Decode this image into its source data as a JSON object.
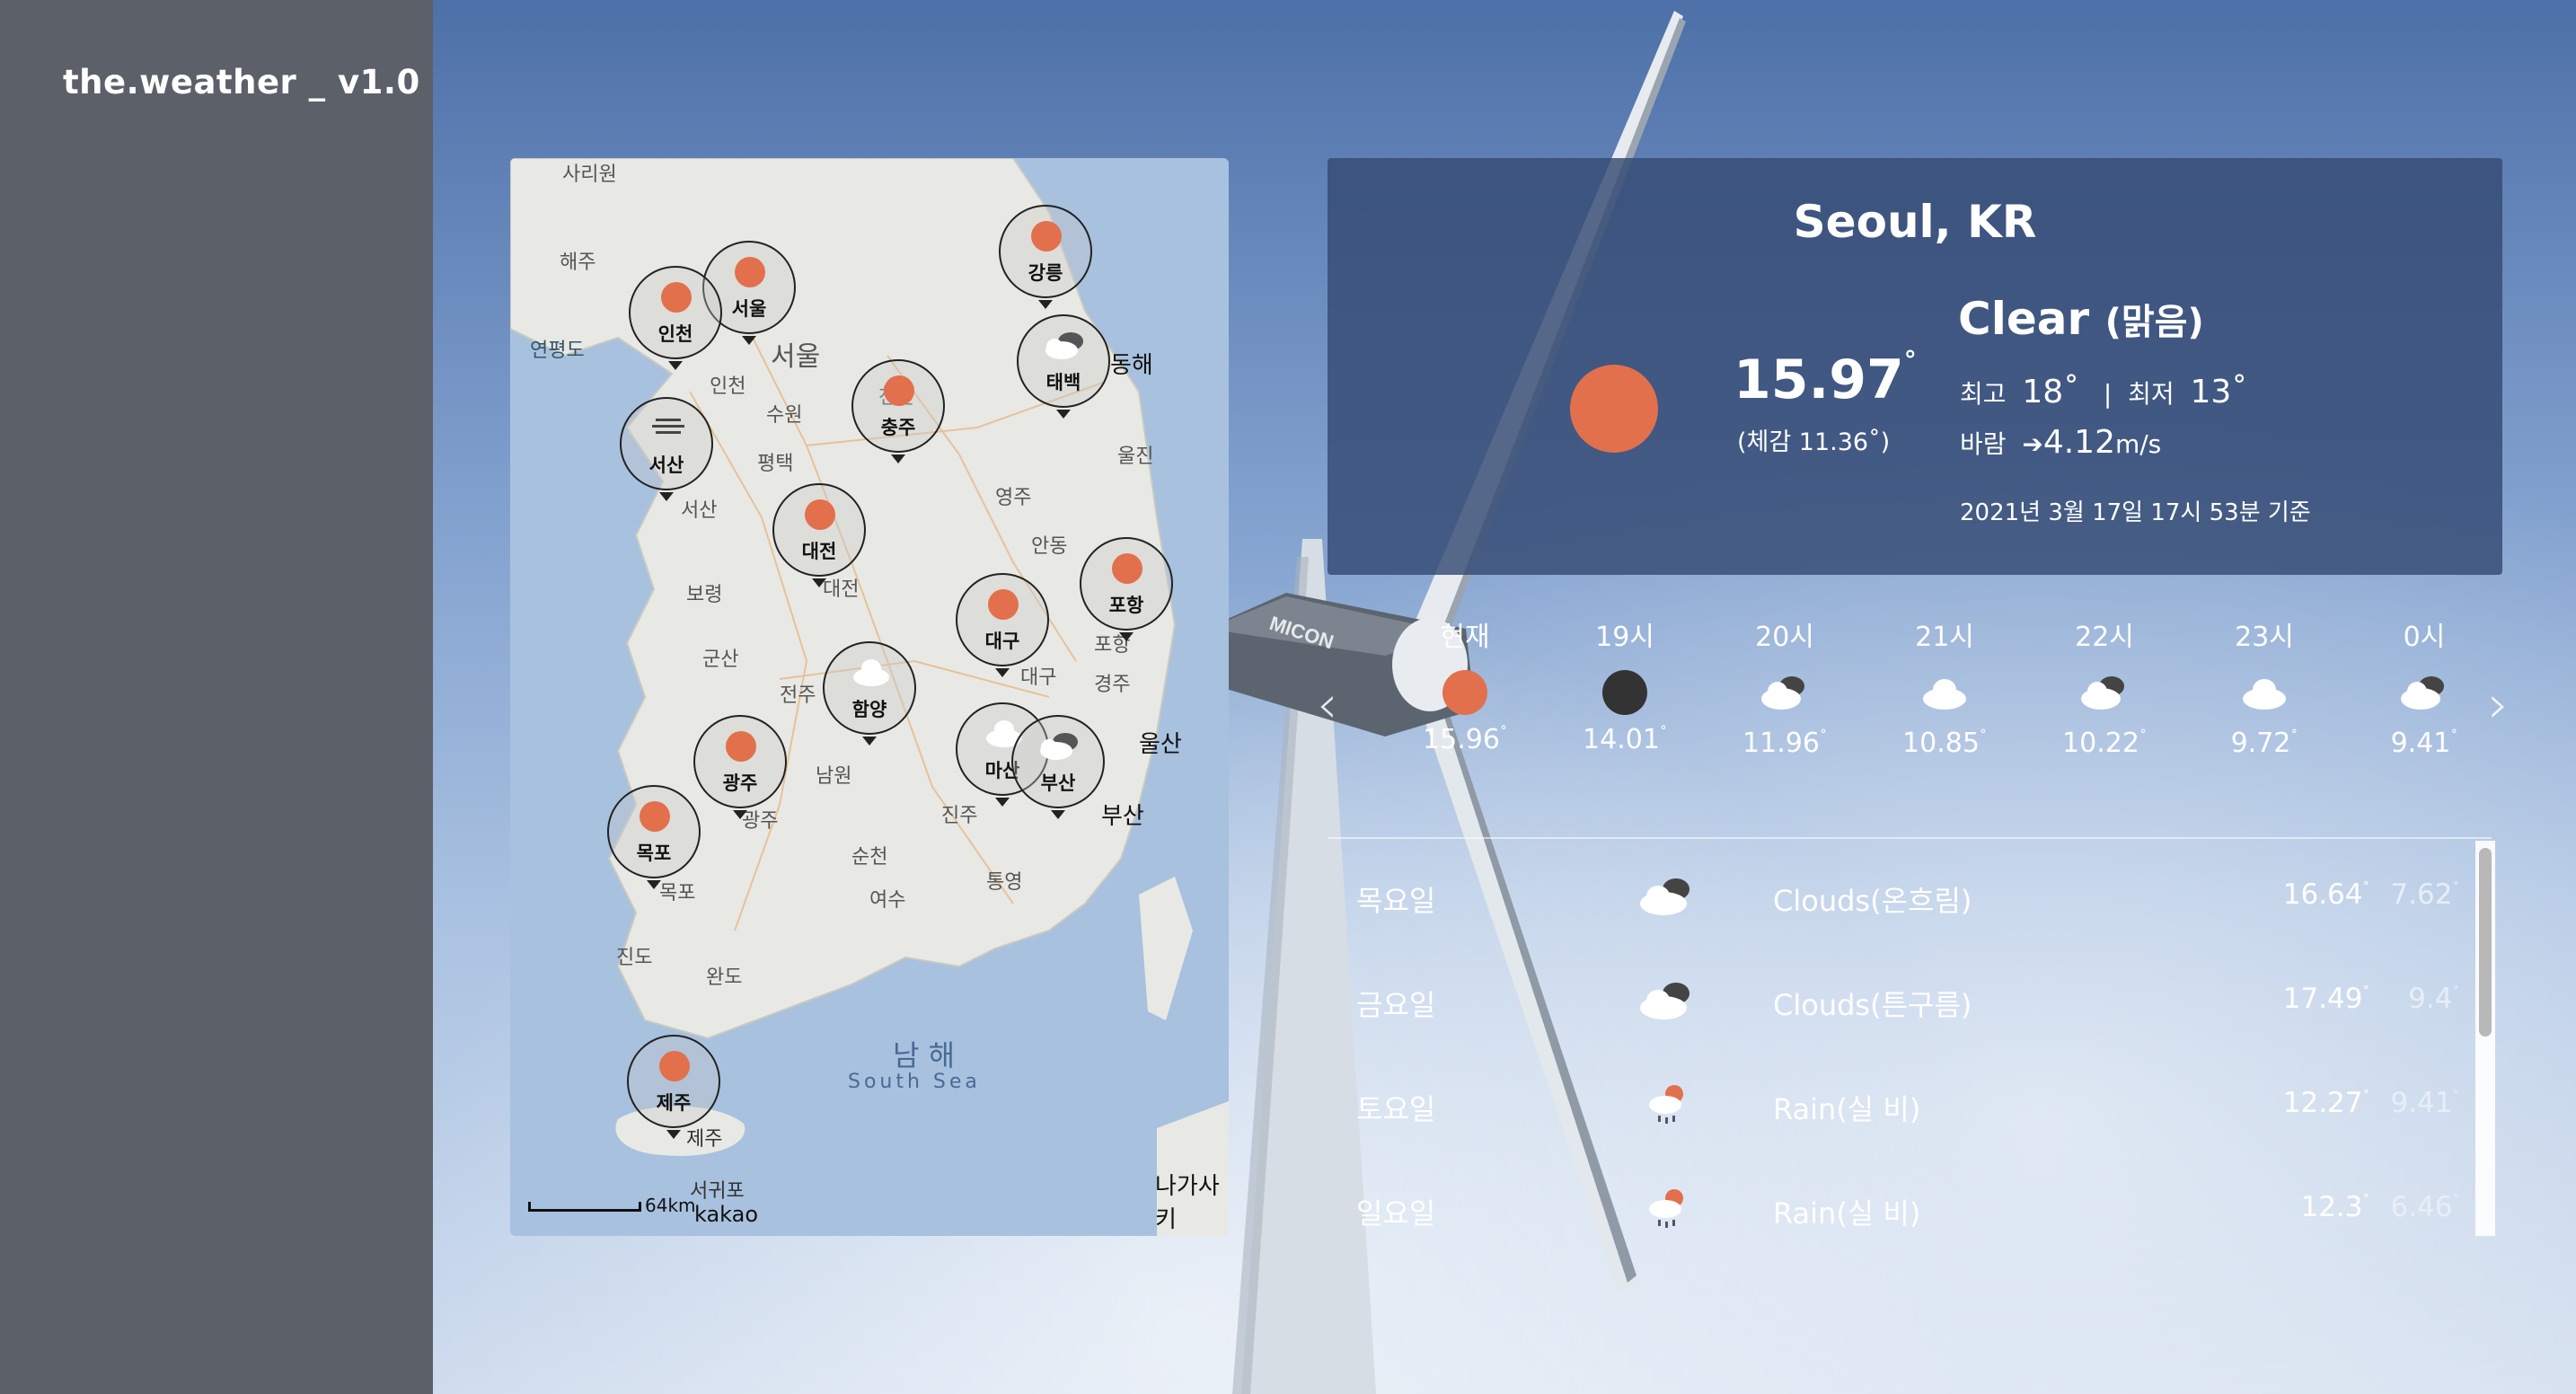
{
  "app": {
    "title": "the.weather _ v1.0"
  },
  "map": {
    "pins": [
      {
        "name": "강릉",
        "icon": "sun"
      },
      {
        "name": "서울",
        "icon": "sun"
      },
      {
        "name": "인천",
        "icon": "sun"
      },
      {
        "name": "태백",
        "icon": "clouds"
      },
      {
        "name": "충주",
        "icon": "sun"
      },
      {
        "name": "서산",
        "icon": "mist"
      },
      {
        "name": "대전",
        "icon": "sun"
      },
      {
        "name": "포항",
        "icon": "sun"
      },
      {
        "name": "대구",
        "icon": "sun"
      },
      {
        "name": "함양",
        "icon": "cloud"
      },
      {
        "name": "광주",
        "icon": "sun"
      },
      {
        "name": "마산",
        "icon": "cloud"
      },
      {
        "name": "부산",
        "icon": "clouds"
      },
      {
        "name": "목포",
        "icon": "sun"
      },
      {
        "name": "제주",
        "icon": "sun"
      }
    ],
    "labels": [
      "사리원",
      "해주",
      "연평도",
      "인천",
      "서울",
      "수원",
      "평택",
      "서산",
      "천안",
      "대전",
      "보령",
      "군산",
      "전주",
      "남원",
      "광주",
      "목포",
      "진도",
      "완도",
      "여수",
      "순천",
      "통영",
      "진주",
      "부산",
      "울산",
      "대구",
      "포항",
      "경주",
      "안동",
      "영주",
      "울진",
      "동해",
      "제주",
      "서귀포",
      "남 해",
      "South Sea",
      "나가사키"
    ],
    "scale": "64km",
    "provider": "kakao"
  },
  "current": {
    "city": "Seoul, KR",
    "condition": "Clear",
    "condition_kr": "(맑음)",
    "temp": "15.97",
    "deg": "°",
    "feels": "(체감 11.36˚)",
    "max_label": "최고",
    "max": "18˚",
    "sep": "|",
    "min_label": "최저",
    "min": "13˚",
    "wind_label": "바람",
    "wind_arrow": "➔",
    "wind": "4.12",
    "wind_unit": "m/s",
    "timestamp": "2021년 3월 17일 17시 53분 기준",
    "sun_color": "#e2704d"
  },
  "hourly": [
    {
      "hour": "현재",
      "icon": "sun",
      "temp": "15.96",
      "deg": "˚"
    },
    {
      "hour": "19시",
      "icon": "moon",
      "temp": "14.01",
      "deg": "˚"
    },
    {
      "hour": "20시",
      "icon": "cloud-dark",
      "temp": "11.96",
      "deg": "˚"
    },
    {
      "hour": "21시",
      "icon": "cloud",
      "temp": "10.85",
      "deg": "˚"
    },
    {
      "hour": "22시",
      "icon": "cloud-dark",
      "temp": "10.22",
      "deg": "˚"
    },
    {
      "hour": "23시",
      "icon": "cloud",
      "temp": "9.72",
      "deg": "˚"
    },
    {
      "hour": "0시",
      "icon": "cloud-dark",
      "temp": "9.41",
      "deg": "˚"
    }
  ],
  "nav": {
    "prev": "‹",
    "next": "›"
  },
  "daily": [
    {
      "day": "목요일",
      "icon": "clouds",
      "cond": "Clouds(온흐림)",
      "hi": "16.64",
      "lo": "7.62",
      "deg": "˚"
    },
    {
      "day": "금요일",
      "icon": "clouds",
      "cond": "Clouds(튼구름)",
      "hi": "17.49",
      "lo": "9.4",
      "deg": "˚"
    },
    {
      "day": "토요일",
      "icon": "rain",
      "cond": "Rain(실 비)",
      "hi": "12.27",
      "lo": "9.41",
      "deg": "˚"
    },
    {
      "day": "일요일",
      "icon": "rain",
      "cond": "Rain(실 비)",
      "hi": "12.3",
      "lo": "6.46",
      "deg": "˚"
    }
  ]
}
